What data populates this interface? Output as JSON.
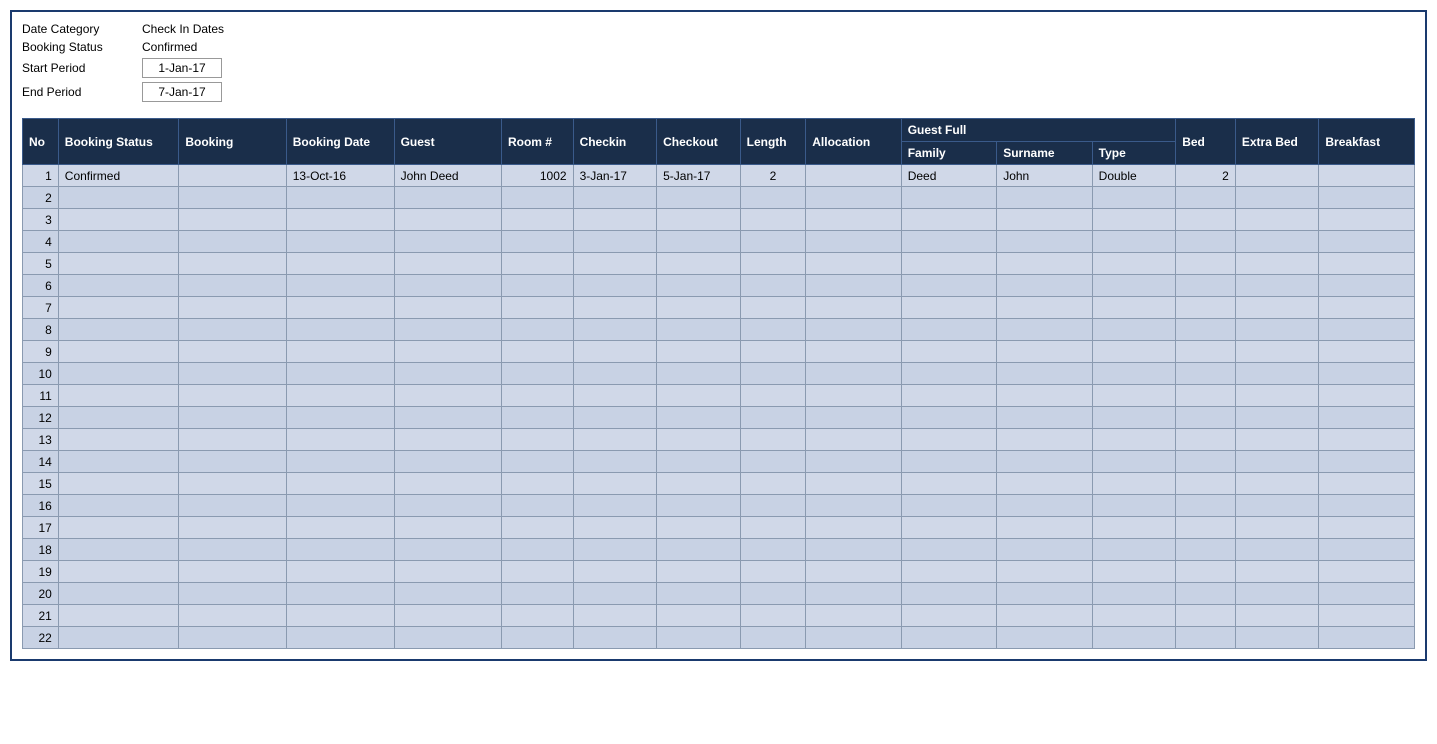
{
  "filters": {
    "date_category_label": "Date Category",
    "date_category_value": "Check In Dates",
    "booking_status_label": "Booking Status",
    "booking_status_value": "Confirmed",
    "start_period_label": "Start Period",
    "start_period_value": "1-Jan-17",
    "end_period_label": "End Period",
    "end_period_value": "7-Jan-17"
  },
  "table": {
    "headers_row1": [
      {
        "key": "no",
        "label": "No",
        "rowspan": 2,
        "colspan": 1
      },
      {
        "key": "booking_status",
        "label": "Booking Status",
        "rowspan": 2,
        "colspan": 1
      },
      {
        "key": "booking",
        "label": "Booking",
        "rowspan": 2,
        "colspan": 1
      },
      {
        "key": "booking_date",
        "label": "Booking Date",
        "rowspan": 2,
        "colspan": 1
      },
      {
        "key": "guest",
        "label": "Guest",
        "rowspan": 2,
        "colspan": 1
      },
      {
        "key": "room",
        "label": "Room #",
        "rowspan": 2,
        "colspan": 1
      },
      {
        "key": "checkin",
        "label": "Checkin",
        "rowspan": 2,
        "colspan": 1
      },
      {
        "key": "checkout",
        "label": "Checkout",
        "rowspan": 2,
        "colspan": 1
      },
      {
        "key": "length",
        "label": "Length",
        "rowspan": 2,
        "colspan": 1
      },
      {
        "key": "allocation",
        "label": "Allocation",
        "rowspan": 2,
        "colspan": 1
      },
      {
        "key": "guest_full",
        "label": "Guest Full",
        "rowspan": 1,
        "colspan": 3
      },
      {
        "key": "bed",
        "label": "Bed",
        "rowspan": 2,
        "colspan": 1
      },
      {
        "key": "extra_bed",
        "label": "Extra Bed",
        "rowspan": 2,
        "colspan": 1
      },
      {
        "key": "breakfast",
        "label": "Breakfast",
        "rowspan": 2,
        "colspan": 1
      }
    ],
    "headers_row2": [
      {
        "key": "family",
        "label": "Family"
      },
      {
        "key": "surname",
        "label": "Surname"
      },
      {
        "key": "type",
        "label": "Type"
      }
    ],
    "rows": [
      {
        "no": 1,
        "booking_status": "Confirmed",
        "booking": "",
        "booking_date": "13-Oct-16",
        "guest": "John Deed",
        "room": "1002",
        "checkin": "3-Jan-17",
        "checkout": "5-Jan-17",
        "length": "2",
        "allocation": "",
        "family": "Deed",
        "surname": "John",
        "type": "Double",
        "bed": "2",
        "extra_bed": "",
        "breakfast": ""
      },
      {
        "no": 2,
        "booking_status": "",
        "booking": "",
        "booking_date": "",
        "guest": "",
        "room": "",
        "checkin": "",
        "checkout": "",
        "length": "",
        "allocation": "",
        "family": "",
        "surname": "",
        "type": "",
        "bed": "",
        "extra_bed": "",
        "breakfast": ""
      },
      {
        "no": 3,
        "booking_status": "",
        "booking": "",
        "booking_date": "",
        "guest": "",
        "room": "",
        "checkin": "",
        "checkout": "",
        "length": "",
        "allocation": "",
        "family": "",
        "surname": "",
        "type": "",
        "bed": "",
        "extra_bed": "",
        "breakfast": ""
      },
      {
        "no": 4,
        "booking_status": "",
        "booking": "",
        "booking_date": "",
        "guest": "",
        "room": "",
        "checkin": "",
        "checkout": "",
        "length": "",
        "allocation": "",
        "family": "",
        "surname": "",
        "type": "",
        "bed": "",
        "extra_bed": "",
        "breakfast": ""
      },
      {
        "no": 5,
        "booking_status": "",
        "booking": "",
        "booking_date": "",
        "guest": "",
        "room": "",
        "checkin": "",
        "checkout": "",
        "length": "",
        "allocation": "",
        "family": "",
        "surname": "",
        "type": "",
        "bed": "",
        "extra_bed": "",
        "breakfast": ""
      },
      {
        "no": 6,
        "booking_status": "",
        "booking": "",
        "booking_date": "",
        "guest": "",
        "room": "",
        "checkin": "",
        "checkout": "",
        "length": "",
        "allocation": "",
        "family": "",
        "surname": "",
        "type": "",
        "bed": "",
        "extra_bed": "",
        "breakfast": ""
      },
      {
        "no": 7,
        "booking_status": "",
        "booking": "",
        "booking_date": "",
        "guest": "",
        "room": "",
        "checkin": "",
        "checkout": "",
        "length": "",
        "allocation": "",
        "family": "",
        "surname": "",
        "type": "",
        "bed": "",
        "extra_bed": "",
        "breakfast": ""
      },
      {
        "no": 8,
        "booking_status": "",
        "booking": "",
        "booking_date": "",
        "guest": "",
        "room": "",
        "checkin": "",
        "checkout": "",
        "length": "",
        "allocation": "",
        "family": "",
        "surname": "",
        "type": "",
        "bed": "",
        "extra_bed": "",
        "breakfast": ""
      },
      {
        "no": 9,
        "booking_status": "",
        "booking": "",
        "booking_date": "",
        "guest": "",
        "room": "",
        "checkin": "",
        "checkout": "",
        "length": "",
        "allocation": "",
        "family": "",
        "surname": "",
        "type": "",
        "bed": "",
        "extra_bed": "",
        "breakfast": ""
      },
      {
        "no": 10,
        "booking_status": "",
        "booking": "",
        "booking_date": "",
        "guest": "",
        "room": "",
        "checkin": "",
        "checkout": "",
        "length": "",
        "allocation": "",
        "family": "",
        "surname": "",
        "type": "",
        "bed": "",
        "extra_bed": "",
        "breakfast": ""
      },
      {
        "no": 11,
        "booking_status": "",
        "booking": "",
        "booking_date": "",
        "guest": "",
        "room": "",
        "checkin": "",
        "checkout": "",
        "length": "",
        "allocation": "",
        "family": "",
        "surname": "",
        "type": "",
        "bed": "",
        "extra_bed": "",
        "breakfast": ""
      },
      {
        "no": 12,
        "booking_status": "",
        "booking": "",
        "booking_date": "",
        "guest": "",
        "room": "",
        "checkin": "",
        "checkout": "",
        "length": "",
        "allocation": "",
        "family": "",
        "surname": "",
        "type": "",
        "bed": "",
        "extra_bed": "",
        "breakfast": ""
      },
      {
        "no": 13,
        "booking_status": "",
        "booking": "",
        "booking_date": "",
        "guest": "",
        "room": "",
        "checkin": "",
        "checkout": "",
        "length": "",
        "allocation": "",
        "family": "",
        "surname": "",
        "type": "",
        "bed": "",
        "extra_bed": "",
        "breakfast": ""
      },
      {
        "no": 14,
        "booking_status": "",
        "booking": "",
        "booking_date": "",
        "guest": "",
        "room": "",
        "checkin": "",
        "checkout": "",
        "length": "",
        "allocation": "",
        "family": "",
        "surname": "",
        "type": "",
        "bed": "",
        "extra_bed": "",
        "breakfast": ""
      },
      {
        "no": 15,
        "booking_status": "",
        "booking": "",
        "booking_date": "",
        "guest": "",
        "room": "",
        "checkin": "",
        "checkout": "",
        "length": "",
        "allocation": "",
        "family": "",
        "surname": "",
        "type": "",
        "bed": "",
        "extra_bed": "",
        "breakfast": ""
      },
      {
        "no": 16,
        "booking_status": "",
        "booking": "",
        "booking_date": "",
        "guest": "",
        "room": "",
        "checkin": "",
        "checkout": "",
        "length": "",
        "allocation": "",
        "family": "",
        "surname": "",
        "type": "",
        "bed": "",
        "extra_bed": "",
        "breakfast": ""
      },
      {
        "no": 17,
        "booking_status": "",
        "booking": "",
        "booking_date": "",
        "guest": "",
        "room": "",
        "checkin": "",
        "checkout": "",
        "length": "",
        "allocation": "",
        "family": "",
        "surname": "",
        "type": "",
        "bed": "",
        "extra_bed": "",
        "breakfast": ""
      },
      {
        "no": 18,
        "booking_status": "",
        "booking": "",
        "booking_date": "",
        "guest": "",
        "room": "",
        "checkin": "",
        "checkout": "",
        "length": "",
        "allocation": "",
        "family": "",
        "surname": "",
        "type": "",
        "bed": "",
        "extra_bed": "",
        "breakfast": ""
      },
      {
        "no": 19,
        "booking_status": "",
        "booking": "",
        "booking_date": "",
        "guest": "",
        "room": "",
        "checkin": "",
        "checkout": "",
        "length": "",
        "allocation": "",
        "family": "",
        "surname": "",
        "type": "",
        "bed": "",
        "extra_bed": "",
        "breakfast": ""
      },
      {
        "no": 20,
        "booking_status": "",
        "booking": "",
        "booking_date": "",
        "guest": "",
        "room": "",
        "checkin": "",
        "checkout": "",
        "length": "",
        "allocation": "",
        "family": "",
        "surname": "",
        "type": "",
        "bed": "",
        "extra_bed": "",
        "breakfast": ""
      },
      {
        "no": 21,
        "booking_status": "",
        "booking": "",
        "booking_date": "",
        "guest": "",
        "room": "",
        "checkin": "",
        "checkout": "",
        "length": "",
        "allocation": "",
        "family": "",
        "surname": "",
        "type": "",
        "bed": "",
        "extra_bed": "",
        "breakfast": ""
      },
      {
        "no": 22,
        "booking_status": "",
        "booking": "",
        "booking_date": "",
        "guest": "",
        "room": "",
        "checkin": "",
        "checkout": "",
        "length": "",
        "allocation": "",
        "family": "",
        "surname": "",
        "type": "",
        "bed": "",
        "extra_bed": "",
        "breakfast": ""
      }
    ]
  }
}
